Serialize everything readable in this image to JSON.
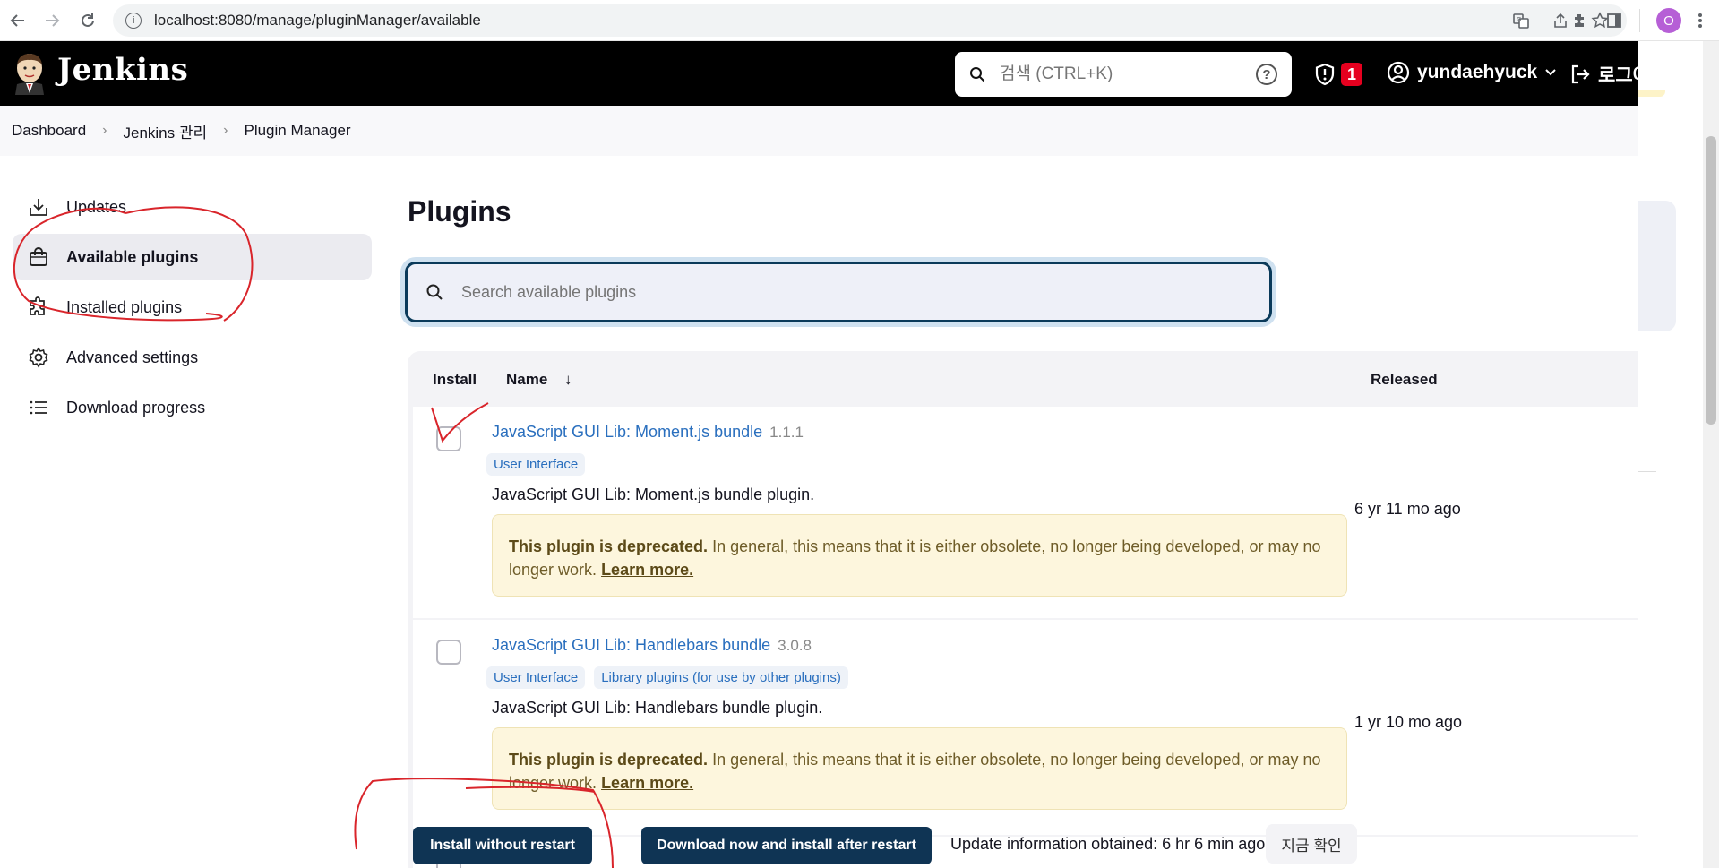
{
  "browser": {
    "url": "localhost:8080/manage/pluginManager/available",
    "profile_initial": "O"
  },
  "header": {
    "brand": "Jenkins",
    "search_placeholder": "검색 (CTRL+K)",
    "help": "?",
    "security_count": "1",
    "username": "yundaehyuck",
    "logout": "로그아웃"
  },
  "breadcrumb": [
    "Dashboard",
    "Jenkins 관리",
    "Plugin Manager"
  ],
  "sidebar": {
    "items": [
      {
        "label": "Updates",
        "icon": "download-icon"
      },
      {
        "label": "Available plugins",
        "icon": "shopping-bag-icon"
      },
      {
        "label": "Installed plugins",
        "icon": "puzzle-icon"
      },
      {
        "label": "Advanced settings",
        "icon": "gear-icon"
      },
      {
        "label": "Download progress",
        "icon": "list-icon"
      }
    ]
  },
  "main": {
    "title": "Plugins",
    "search_placeholder": "Search available plugins",
    "columns": {
      "install": "Install",
      "name": "Name",
      "sort_arrow": "↓",
      "released": "Released"
    },
    "plugins": [
      {
        "name": "JavaScript GUI Lib: Moment.js bundle",
        "version": "1.1.1",
        "tags": [
          "User Interface"
        ],
        "description": "JavaScript GUI Lib: Moment.js bundle plugin.",
        "warning_bold": "This plugin is deprecated.",
        "warning_text": "In general, this means that it is either obsolete, no longer being developed, or may no longer work.",
        "learn_more": "Learn more.",
        "released": "6 yr 11 mo ago"
      },
      {
        "name": "JavaScript GUI Lib: Handlebars bundle",
        "version": "3.0.8",
        "tags": [
          "User Interface",
          "Library plugins (for use by other plugins)"
        ],
        "description": "JavaScript GUI Lib: Handlebars bundle plugin.",
        "warning_bold": "This plugin is deprecated.",
        "warning_text": "In general, this means that it is either obsolete, no longer being developed, or may no longer work.",
        "learn_more": "Learn more.",
        "released": "1 yr 10 mo ago"
      }
    ]
  },
  "actions": {
    "install_without_restart": "Install without restart",
    "download_install_after_restart": "Download now and install after restart",
    "update_info": "Update information obtained: 6 hr 6 min ago",
    "check_now": "지금 확인"
  },
  "annotation_color": "#d9252b"
}
